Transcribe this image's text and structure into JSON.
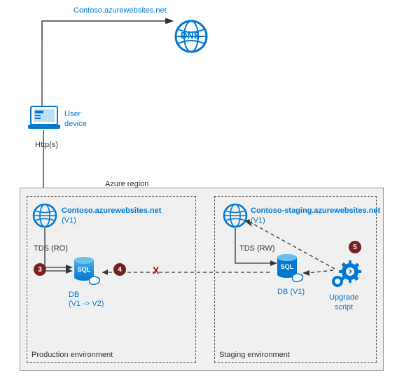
{
  "top": {
    "dns_url": "Contoso.azurewebsites.net",
    "dns_label": "DNS",
    "user_device": "User\ndevice",
    "http": "Http(s)"
  },
  "region": {
    "title": "Azure region",
    "production": {
      "env_label": "Production environment",
      "app_name": "Contoso.azurewebsites.net",
      "app_version": "(V1)",
      "tds": "TDS (RO)",
      "db_label": "DB",
      "db_version": "(V1 -> V2)"
    },
    "staging": {
      "env_label": "Staging environment",
      "app_name": "Contoso-staging.azurewebsites.net",
      "app_version": "(V1)",
      "tds": "TDS (RW)",
      "db_label": "DB (V1)",
      "upgrade": "Upgrade\nscript"
    },
    "steps": {
      "s3": "3",
      "s4": "4",
      "s5": "5"
    },
    "x": "X"
  }
}
